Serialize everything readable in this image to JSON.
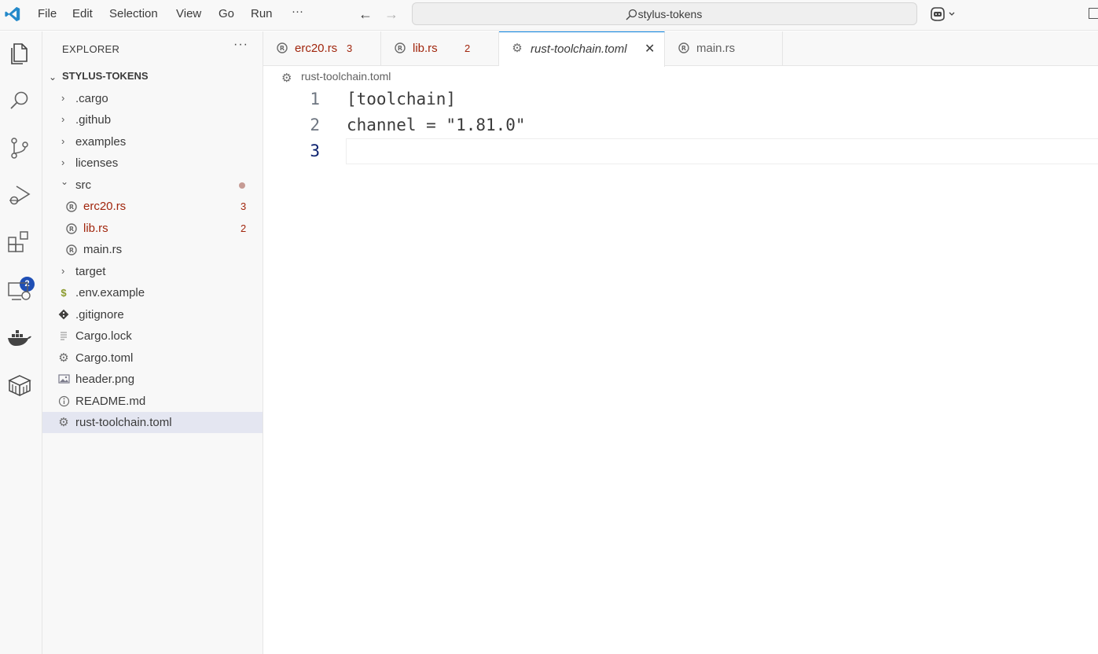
{
  "titlebar": {
    "menu": [
      "File",
      "Edit",
      "Selection",
      "View",
      "Go",
      "Run"
    ],
    "more": "···",
    "search_text": "stylus-tokens"
  },
  "activitybar": {
    "items": [
      "explorer-icon",
      "search-icon",
      "source-control-icon",
      "run-debug-icon",
      "extensions-icon",
      "remote-explorer-icon",
      "docker-icon",
      "package-icon"
    ],
    "extensions_badge": "2"
  },
  "sidebar": {
    "title": "EXPLORER",
    "more": "···",
    "root": "STYLUS-TOKENS",
    "items": [
      {
        "name": ".cargo",
        "kind": "folder",
        "expanded": false
      },
      {
        "name": ".github",
        "kind": "folder",
        "expanded": false
      },
      {
        "name": "examples",
        "kind": "folder",
        "expanded": false
      },
      {
        "name": "licenses",
        "kind": "folder",
        "expanded": false
      },
      {
        "name": "src",
        "kind": "folder",
        "expanded": true
      },
      {
        "name": "erc20.rs",
        "kind": "rust",
        "count": "3"
      },
      {
        "name": "lib.rs",
        "kind": "rust",
        "count": "2"
      },
      {
        "name": "main.rs",
        "kind": "rust"
      },
      {
        "name": "target",
        "kind": "folder",
        "expanded": false
      },
      {
        "name": ".env.example",
        "kind": "env"
      },
      {
        "name": ".gitignore",
        "kind": "git"
      },
      {
        "name": "Cargo.lock",
        "kind": "lock"
      },
      {
        "name": "Cargo.toml",
        "kind": "gear"
      },
      {
        "name": "header.png",
        "kind": "image"
      },
      {
        "name": "README.md",
        "kind": "info"
      },
      {
        "name": "rust-toolchain.toml",
        "kind": "gear",
        "selected": true
      }
    ]
  },
  "tabs": [
    {
      "label": "erc20.rs",
      "count": "3"
    },
    {
      "label": "lib.rs",
      "count": "2"
    },
    {
      "label": "rust-toolchain.toml",
      "active": true
    },
    {
      "label": "main.rs"
    }
  ],
  "breadcrumb": "rust-toolchain.toml",
  "editor": {
    "lines": [
      {
        "number": "1",
        "text": "[toolchain]"
      },
      {
        "number": "2",
        "text": "channel = \"1.81.0\""
      },
      {
        "number": "3",
        "text": ""
      }
    ]
  },
  "colors": {
    "accent": "#0078d4",
    "error": "#a1260d",
    "badge": "#1f4fb5",
    "selection": "#e4e6f1"
  }
}
